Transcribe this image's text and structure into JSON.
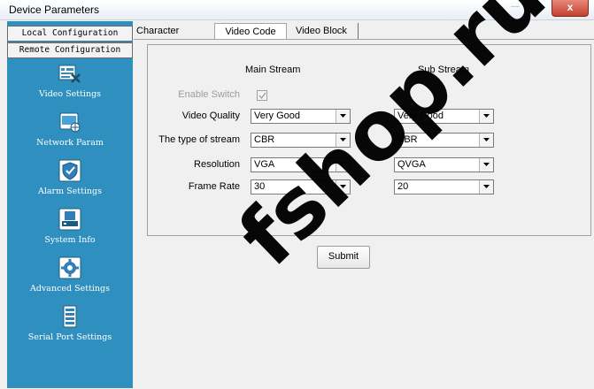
{
  "window": {
    "title": "Device Parameters",
    "close_glyph": "x"
  },
  "sidebar": {
    "tabs": [
      {
        "label": "Local Configuration"
      },
      {
        "label": "Remote Configuration"
      }
    ],
    "items": [
      {
        "label": "Video Settings",
        "icon": "video-settings-icon"
      },
      {
        "label": "Network Param",
        "icon": "network-icon"
      },
      {
        "label": "Alarm Settings",
        "icon": "shield-icon"
      },
      {
        "label": "System Info",
        "icon": "system-info-icon"
      },
      {
        "label": "Advanced Settings",
        "icon": "gear-icon"
      },
      {
        "label": "Serial Port Settings",
        "icon": "serial-port-icon"
      }
    ],
    "bg_color": "#2f8fbf"
  },
  "tabs": [
    {
      "label": "Character Overlay"
    },
    {
      "label": "Video Code",
      "active": true
    },
    {
      "label": "Video Block"
    }
  ],
  "form": {
    "main_header": "Main Stream",
    "sub_header": "Sub Stream",
    "rows": [
      {
        "label": "Enable Switch",
        "type": "checkbox",
        "main_checked": true,
        "sub_checked": true,
        "disabled": true
      },
      {
        "label": "Video Quality",
        "type": "select",
        "main": "Very Good",
        "sub": "Very Good"
      },
      {
        "label": "The type of stream",
        "type": "select",
        "main": "CBR",
        "sub": "VBR"
      },
      {
        "label": "Resolution",
        "type": "select",
        "main": "VGA",
        "sub": "QVGA"
      },
      {
        "label": "Frame Rate",
        "type": "select",
        "main": "30",
        "sub": "20"
      }
    ],
    "submit_label": "Submit"
  },
  "watermark": {
    "text": "fshop.ru"
  }
}
